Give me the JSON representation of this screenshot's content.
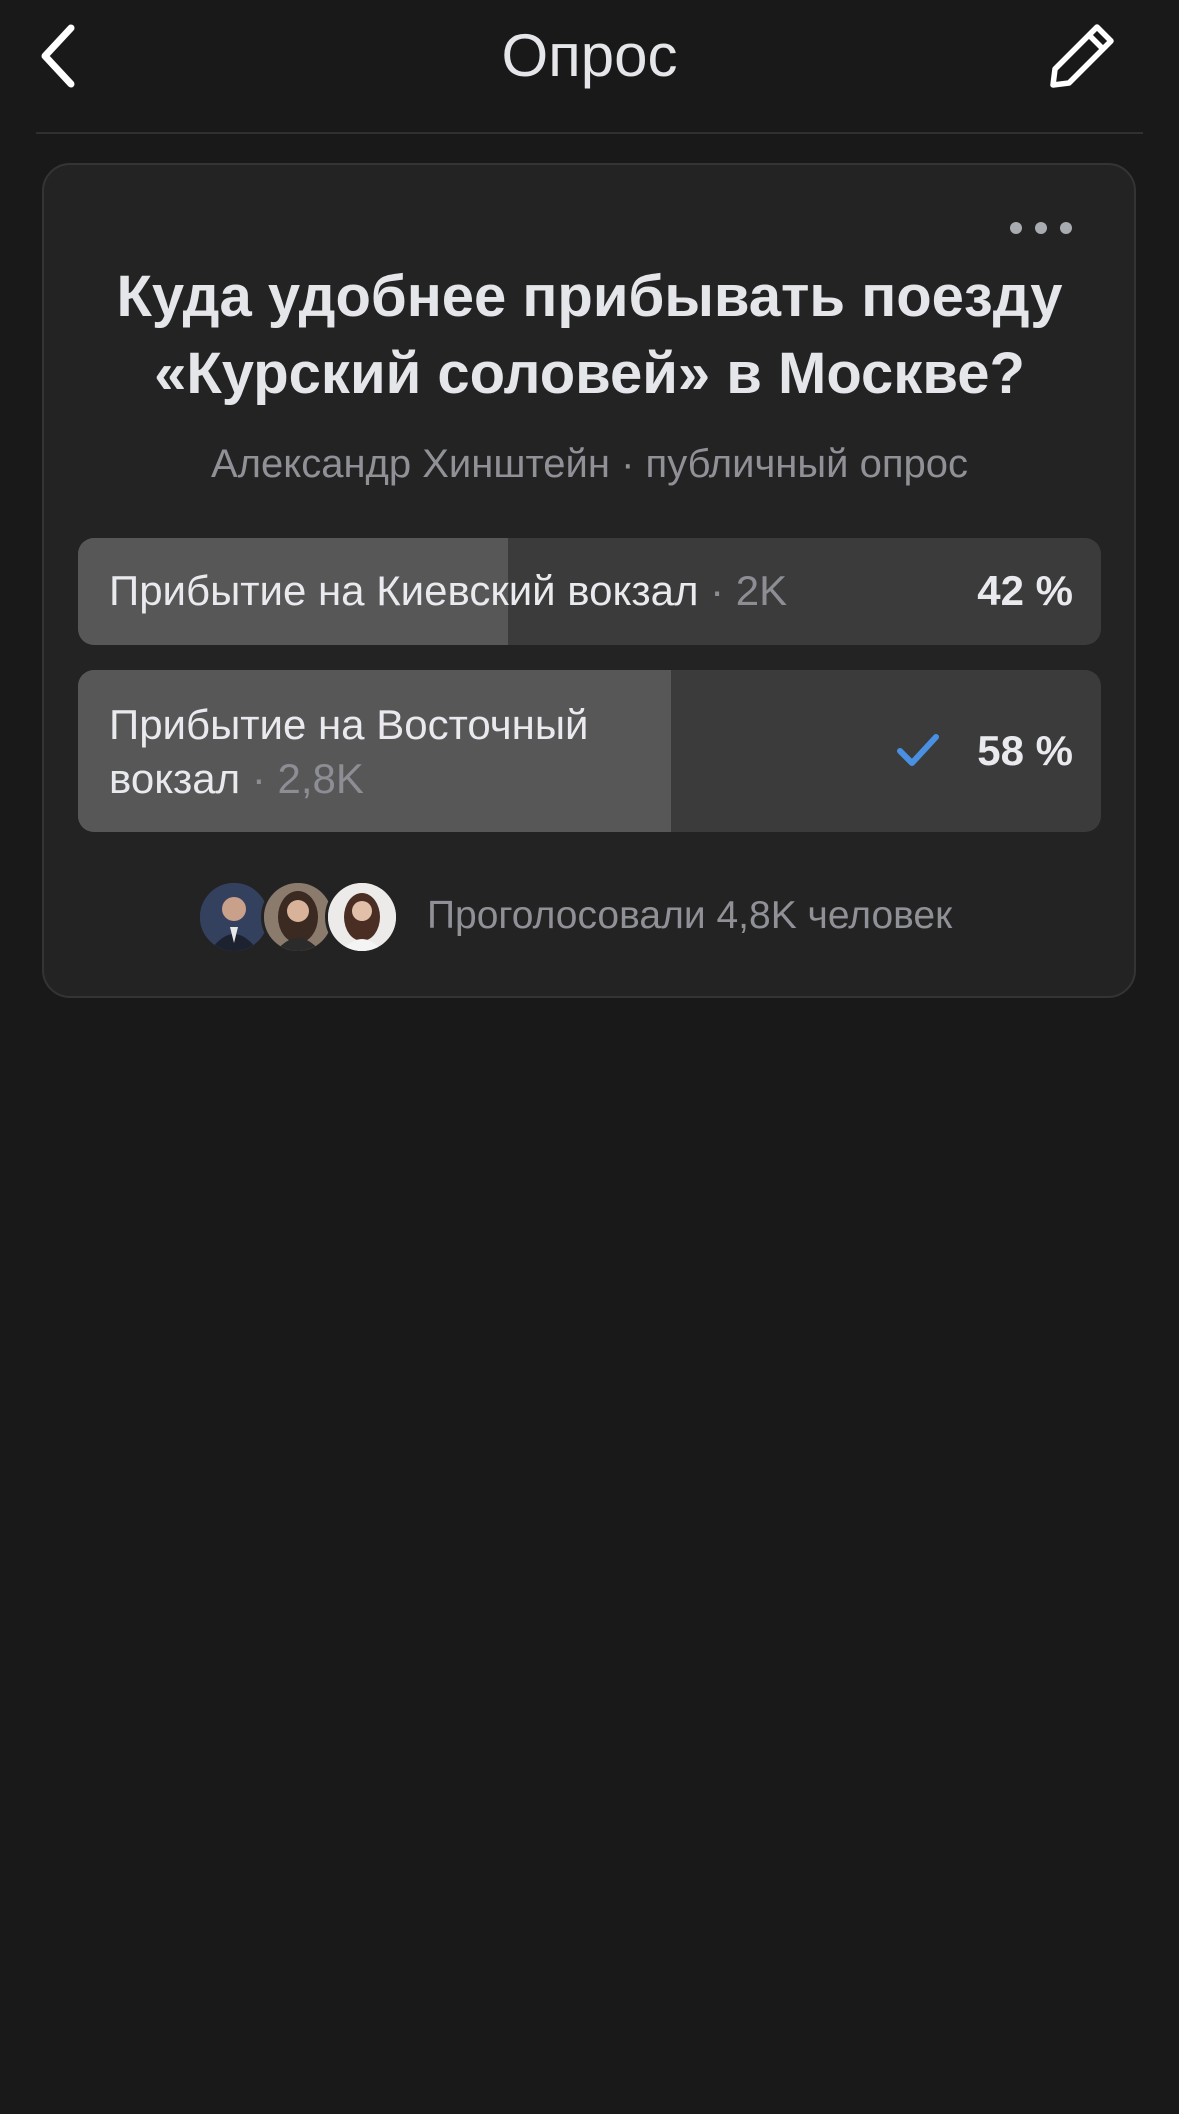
{
  "header": {
    "title": "Опрос",
    "back_icon": "chevron-left-icon",
    "edit_icon": "pencil-icon"
  },
  "poll": {
    "menu_icon": "more-horizontal-icon",
    "question": "Куда удобнее прибывать поезду «Курский соловей» в Москве?",
    "author": "Александр Хинштейн",
    "separator": " · ",
    "type": "публичный опрос",
    "options": [
      {
        "text": "Прибытие на Киевский вокзал",
        "count": "· 2K",
        "percent_label": "42 %",
        "share": 0.42,
        "selected": false
      },
      {
        "text": "Прибытие на Восточный вокзал",
        "count": "· 2,8K",
        "percent_label": "58 %",
        "share": 0.58,
        "selected": true
      }
    ],
    "voters_text": "Проголосовали 4,8K человек"
  },
  "colors": {
    "background": "#19191a",
    "card": "#232324",
    "option_track": "#3b3b3c",
    "option_fill": "#575758",
    "check_accent": "#4a90e2"
  }
}
